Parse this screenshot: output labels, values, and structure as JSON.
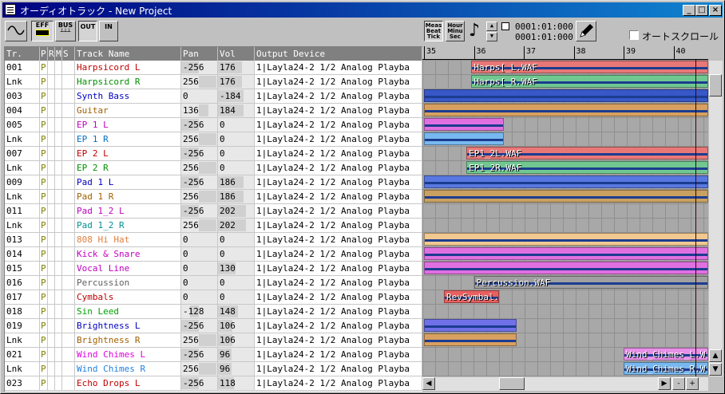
{
  "window": {
    "title": "オーディオトラック - New Project"
  },
  "titlebar_buttons": {
    "minimize": "_",
    "maximize": "□",
    "close": "×"
  },
  "toolbar": {
    "eff_label": "EFF",
    "bus_label": "BUS",
    "out_label": "OUT",
    "in_label": "IN",
    "meas_label_1": "Meas",
    "meas_label_2": "Beat",
    "meas_label_3": "Tick",
    "hour_label_1": "Hour",
    "hour_label_2": "Minu",
    "hour_label_3": "Sec",
    "counter_1": "0001:01:000",
    "counter_2": "0001:01:000",
    "autoscroll_label": "オートスクロール"
  },
  "table": {
    "headers": {
      "tr": "Tr.",
      "p": "P",
      "r": "R",
      "m": "M",
      "s": "S",
      "name": "Track Name",
      "pan": "Pan",
      "vol": "Vol",
      "out": "Output Device"
    },
    "rows": [
      {
        "tr": "001",
        "p": "P",
        "name": "Harpsicord L",
        "color": "#c00000",
        "pan": "-256",
        "vol": "176",
        "out": "1|Layla24-2 1/2 Analog Playba"
      },
      {
        "tr": "Lnk",
        "p": "P",
        "name": "Harpsicord R",
        "color": "#009000",
        "pan": "256",
        "vol": "176",
        "out": "1|Layla24-2 1/2 Analog Playba"
      },
      {
        "tr": "003",
        "p": "P",
        "name": "Synth Bass",
        "color": "#0000c0",
        "pan": "0",
        "vol": "-184",
        "out": "1|Layla24-2 1/2 Analog Playba"
      },
      {
        "tr": "004",
        "p": "P",
        "name": "Guitar",
        "color": "#a06000",
        "pan": "136",
        "vol": "184",
        "out": "1|Layla24-2 1/2 Analog Playba"
      },
      {
        "tr": "005",
        "p": "P",
        "name": "EP 1 L",
        "color": "#c000c0",
        "pan": "-256",
        "vol": "0",
        "out": "1|Layla24-2 1/2 Analog Playba"
      },
      {
        "tr": "Lnk",
        "p": "P",
        "name": "EP 1 R",
        "color": "#0070c0",
        "pan": "256",
        "vol": "0",
        "out": "1|Layla24-2 1/2 Analog Playba"
      },
      {
        "tr": "007",
        "p": "P",
        "name": "EP 2 L",
        "color": "#c00000",
        "pan": "-256",
        "vol": "0",
        "out": "1|Layla24-2 1/2 Analog Playba"
      },
      {
        "tr": "Lnk",
        "p": "P",
        "name": "EP 2 R",
        "color": "#009000",
        "pan": "256",
        "vol": "0",
        "out": "1|Layla24-2 1/2 Analog Playba"
      },
      {
        "tr": "009",
        "p": "P",
        "name": "Pad 1 L",
        "color": "#0000c0",
        "pan": "-256",
        "vol": "186",
        "out": "1|Layla24-2 1/2 Analog Playba"
      },
      {
        "tr": "Lnk",
        "p": "P",
        "name": "Pad 1 R",
        "color": "#a06000",
        "pan": "256",
        "vol": "186",
        "out": "1|Layla24-2 1/2 Analog Playba"
      },
      {
        "tr": "011",
        "p": "P",
        "name": "Pad 1_2 L",
        "color": "#c000c0",
        "pan": "-256",
        "vol": "202",
        "out": "1|Layla24-2 1/2 Analog Playba"
      },
      {
        "tr": "Lnk",
        "p": "P",
        "name": "Pad 1_2 R",
        "color": "#009090",
        "pan": "256",
        "vol": "202",
        "out": "1|Layla24-2 1/2 Analog Playba"
      },
      {
        "tr": "013",
        "p": "P",
        "name": "808 Hi Hat",
        "color": "#e08040",
        "pan": "0",
        "vol": "0",
        "out": "1|Layla24-2 1/2 Analog Playba"
      },
      {
        "tr": "014",
        "p": "P",
        "name": "Kick & Snare",
        "color": "#c000c0",
        "pan": "0",
        "vol": "0",
        "out": "1|Layla24-2 1/2 Analog Playba"
      },
      {
        "tr": "015",
        "p": "P",
        "name": "Vocal Line",
        "color": "#c000c0",
        "pan": "0",
        "vol": "130",
        "out": "1|Layla24-2 1/2 Analog Playba"
      },
      {
        "tr": "016",
        "p": "P",
        "name": "Percussion",
        "color": "#606060",
        "pan": "0",
        "vol": "0",
        "out": "1|Layla24-2 1/2 Analog Playba"
      },
      {
        "tr": "017",
        "p": "P",
        "name": "Cymbals",
        "color": "#c00000",
        "pan": "0",
        "vol": "0",
        "out": "1|Layla24-2 1/2 Analog Playba"
      },
      {
        "tr": "018",
        "p": "P",
        "name": "Sin Leed",
        "color": "#00a000",
        "pan": "-128",
        "vol": "148",
        "out": "1|Layla24-2 1/2 Analog Playba"
      },
      {
        "tr": "019",
        "p": "P",
        "name": "Brightness L",
        "color": "#0000c0",
        "pan": "-256",
        "vol": "106",
        "out": "1|Layla24-2 1/2 Analog Playba"
      },
      {
        "tr": "Lnk",
        "p": "P",
        "name": "Brightness R",
        "color": "#a06000",
        "pan": "256",
        "vol": "106",
        "out": "1|Layla24-2 1/2 Analog Playba"
      },
      {
        "tr": "021",
        "p": "P",
        "name": "Wind Chimes L",
        "color": "#e000e0",
        "pan": "-256",
        "vol": "96",
        "out": "1|Layla24-2 1/2 Analog Playba"
      },
      {
        "tr": "Lnk",
        "p": "P",
        "name": "Wind Chimes R",
        "color": "#2080e0",
        "pan": "256",
        "vol": "96",
        "out": "1|Layla24-2 1/2 Analog Playba"
      },
      {
        "tr": "023",
        "p": "P",
        "name": "Echo Drops L",
        "color": "#c00000",
        "pan": "-256",
        "vol": "118",
        "out": "1|Layla24-2 1/2 Analog Playba"
      }
    ]
  },
  "timeline": {
    "measures": [
      "35",
      "36",
      "37",
      "38",
      "39",
      "40"
    ],
    "clips": [
      {
        "lane": 0,
        "from": 35.95,
        "to": 41.5,
        "label": "Harps[_L.WAF",
        "color": "#e87878"
      },
      {
        "lane": 1,
        "from": 35.95,
        "to": 41.5,
        "label": "Harps[_R.WAF",
        "color": "#70c890"
      },
      {
        "lane": 2,
        "from": 35.0,
        "to": 41.5,
        "label": "",
        "color": "#3858c8"
      },
      {
        "lane": 3,
        "from": 35.0,
        "to": 41.5,
        "label": "",
        "color": "#d8a060"
      },
      {
        "lane": 4,
        "from": 35.0,
        "to": 36.6,
        "label": "",
        "color": "#e070e0"
      },
      {
        "lane": 5,
        "from": 35.0,
        "to": 36.6,
        "label": "",
        "color": "#78b8f0"
      },
      {
        "lane": 6,
        "from": 35.85,
        "to": 41.5,
        "label": "EP1_2L.WAF",
        "color": "#e87878"
      },
      {
        "lane": 7,
        "from": 35.85,
        "to": 41.5,
        "label": "EP1_2R.WAF",
        "color": "#70c890"
      },
      {
        "lane": 8,
        "from": 35.0,
        "to": 41.5,
        "label": "",
        "color": "#5878e0"
      },
      {
        "lane": 9,
        "from": 35.0,
        "to": 41.5,
        "label": "",
        "color": "#c8a060"
      },
      {
        "lane": 12,
        "from": 35.0,
        "to": 41.5,
        "label": "",
        "color": "#f0c890"
      },
      {
        "lane": 13,
        "from": 35.0,
        "to": 41.5,
        "label": "",
        "color": "#e070e0"
      },
      {
        "lane": 14,
        "from": 35.0,
        "to": 41.5,
        "label": "",
        "color": "#e070e0"
      },
      {
        "lane": 15,
        "from": 36.0,
        "to": 41.5,
        "label": "Percussion.WAF",
        "color": "#a0a0a0"
      },
      {
        "lane": 16,
        "from": 35.4,
        "to": 36.5,
        "label": "RevSymbal.WAF",
        "color": "#e86060"
      },
      {
        "lane": 18,
        "from": 35.0,
        "to": 36.85,
        "label": "",
        "color": "#7070e8"
      },
      {
        "lane": 19,
        "from": 35.0,
        "to": 36.85,
        "label": "",
        "color": "#d8a060"
      },
      {
        "lane": 20,
        "from": 39.0,
        "to": 41.5,
        "label": "Wind_Chimes_L.W",
        "color": "#e890e8"
      },
      {
        "lane": 21,
        "from": 39.0,
        "to": 41.5,
        "label": "Wind_Chimes_R.W",
        "color": "#78b8f0"
      }
    ]
  },
  "scroll": {
    "minus_label": "-",
    "plus_label": "+"
  }
}
